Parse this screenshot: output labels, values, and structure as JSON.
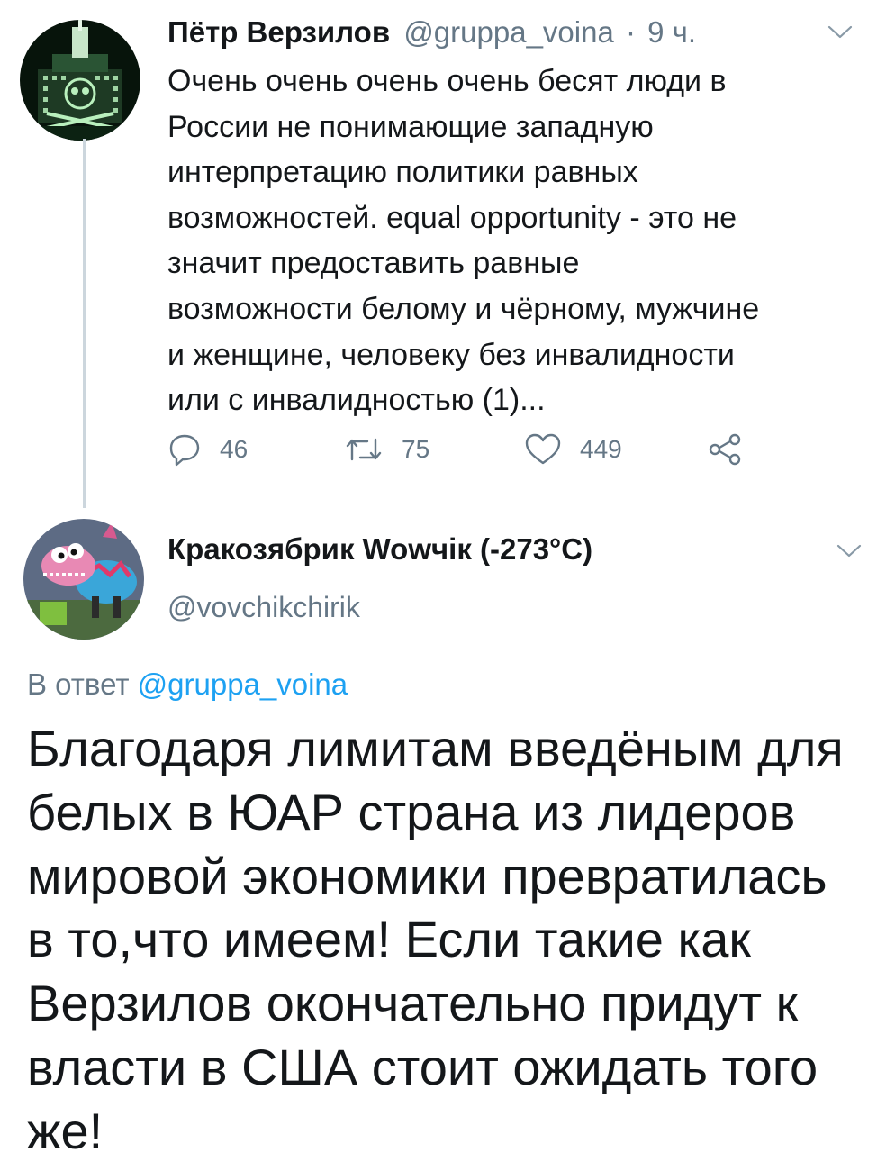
{
  "tweet": {
    "author_name": "Пётр Верзилов",
    "author_handle": "@gruppa_voina",
    "separator": "·",
    "time": "9 ч.",
    "avatar_icon": "building-skull-avatar",
    "body_lines": [
      "Очень очень очень очень бесят люди в",
      "России не понимающие западную",
      "интерпретацию политики равных",
      "возможностей. equal opportunity - это не",
      "значит предоставить равные",
      "возможности белому и чёрному, мужчине",
      "и женщине, человеку без инвалидности",
      "или с инвалидностью (1)..."
    ],
    "actions": {
      "reply_icon": "reply-icon",
      "reply_count": "46",
      "retweet_icon": "retweet-icon",
      "retweet_count": "75",
      "like_icon": "heart-icon",
      "like_count": "449",
      "share_icon": "share-icon"
    }
  },
  "reply": {
    "author_name": "Кракозябрик Wowчік (-273°С)",
    "author_handle": "@vovchikchirik",
    "avatar_icon": "cartoon-creature-avatar",
    "in_reply_to_prefix": "В ответ",
    "in_reply_to_handle": "@gruppa_voina",
    "body_lines": [
      "Благодаря лимитам введёным для",
      "белых в ЮАР страна из лидеров",
      "мировой экономики превратилась",
      "в то,что имеем! Если такие как",
      "Верзилов окончательно придут к",
      "власти в США стоит ожидать того",
      "же!"
    ]
  },
  "colors": {
    "text": "#14171a",
    "secondary": "#657786",
    "link": "#1da1f2",
    "thread_line": "#ccd6dd",
    "background": "#ffffff"
  }
}
